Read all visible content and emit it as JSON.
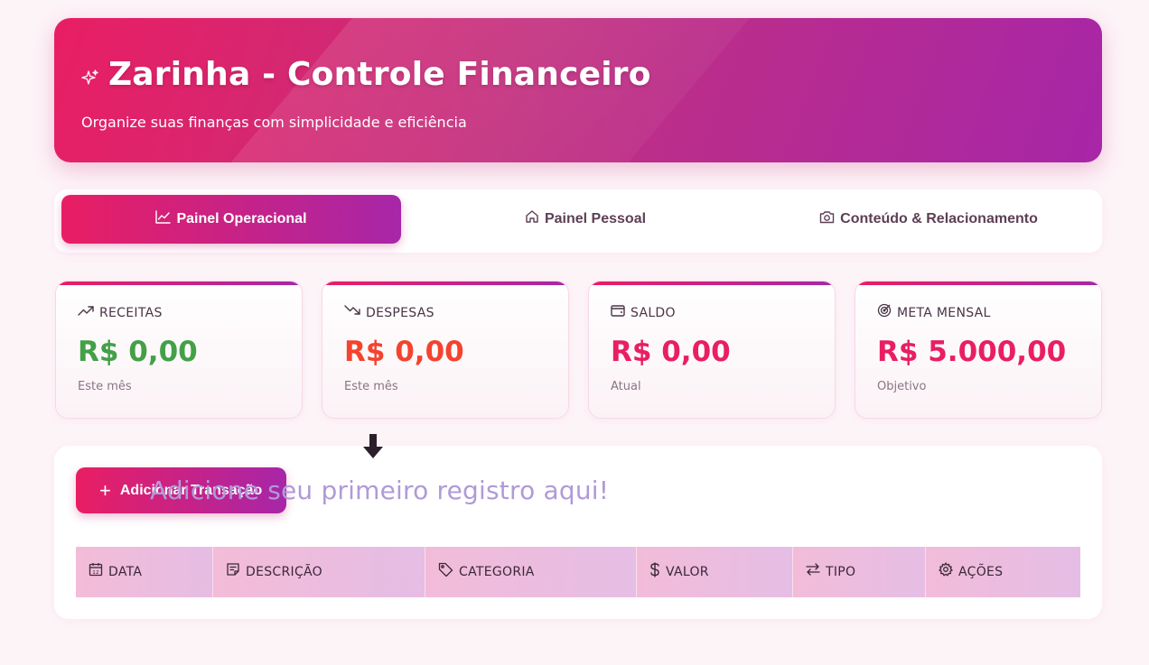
{
  "header": {
    "title": "Zarinha - Controle Financeiro",
    "subtitle": "Organize suas finanças com simplicidade e eficiência",
    "icon": "sparkle-icon"
  },
  "tabs": [
    {
      "label": "Painel Operacional",
      "icon": "chart-line-icon",
      "active": true
    },
    {
      "label": "Painel Pessoal",
      "icon": "home-icon",
      "active": false
    },
    {
      "label": "Conteúdo & Relacionamento",
      "icon": "camera-icon",
      "active": false
    }
  ],
  "cards": [
    {
      "label": "RECEITAS",
      "value": "R$ 0,00",
      "sub": "Este mês",
      "color": "#43a047",
      "icon": "trending-up-icon"
    },
    {
      "label": "DESPESAS",
      "value": "R$ 0,00",
      "sub": "Este mês",
      "color": "#f4432e",
      "icon": "trending-down-icon"
    },
    {
      "label": "SALDO",
      "value": "R$ 0,00",
      "sub": "Atual",
      "color": "#e91e63",
      "icon": "wallet-icon"
    },
    {
      "label": "META MENSAL",
      "value": "R$ 5.000,00",
      "sub": "Objetivo",
      "color": "#e91e63",
      "icon": "target-icon"
    }
  ],
  "transactions": {
    "add_button_label": "Adicionar Transação",
    "empty_hint": "Adicione seu primeiro registro aqui!",
    "columns": [
      {
        "label": "DATA",
        "icon": "calendar-icon"
      },
      {
        "label": "DESCRIÇÃO",
        "icon": "note-icon"
      },
      {
        "label": "CATEGORIA",
        "icon": "tag-icon"
      },
      {
        "label": "VALOR",
        "icon": "dollar-icon"
      },
      {
        "label": "TIPO",
        "icon": "swap-icon"
      },
      {
        "label": "AÇÕES",
        "icon": "gear-icon"
      }
    ]
  },
  "colors": {
    "accent_start": "#e91e63",
    "accent_end": "#a726a8",
    "background": "#fdf4f8"
  }
}
